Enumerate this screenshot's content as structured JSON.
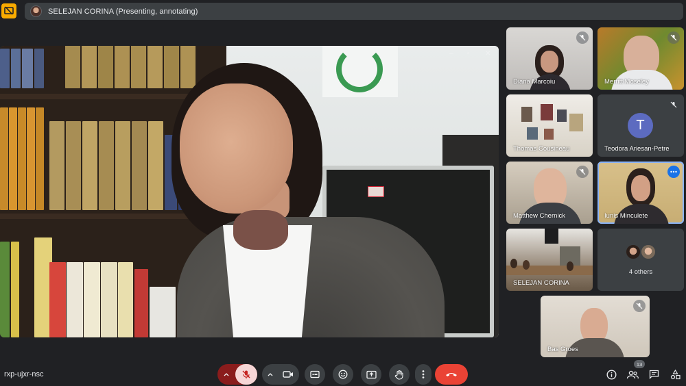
{
  "presenter_bar": {
    "text": "SELEJAN CORINA (Presenting, annotating)",
    "icon": "present-icon",
    "accent": "#f9ab00"
  },
  "main_video": {
    "window_controls": [
      "–",
      "▫",
      "✕"
    ]
  },
  "tiles": [
    {
      "name": "Diana Marcoiu",
      "muted": true
    },
    {
      "name": "Merritt Moseley",
      "muted": true
    },
    {
      "name": "Thomas Cousineau",
      "muted": false
    },
    {
      "name": "Teodora Ariesan-Petre",
      "muted": true,
      "avatar_letter": "T"
    },
    {
      "name": "Matthew Chernick",
      "muted": true
    },
    {
      "name": "Iunis Minculete",
      "muted": false,
      "active": true
    },
    {
      "name": "SELEJAN CORINA",
      "muted": false
    },
    {
      "name": "4 others"
    },
    {
      "name": "Bas Groes",
      "muted": true
    }
  ],
  "bottom_bar": {
    "meeting_code": "rxp-ujxr-nsc",
    "people_count": "13",
    "colors": {
      "mic_off": "#8a1c1c",
      "hangup": "#ea4335",
      "bar": "#3c4043"
    }
  }
}
